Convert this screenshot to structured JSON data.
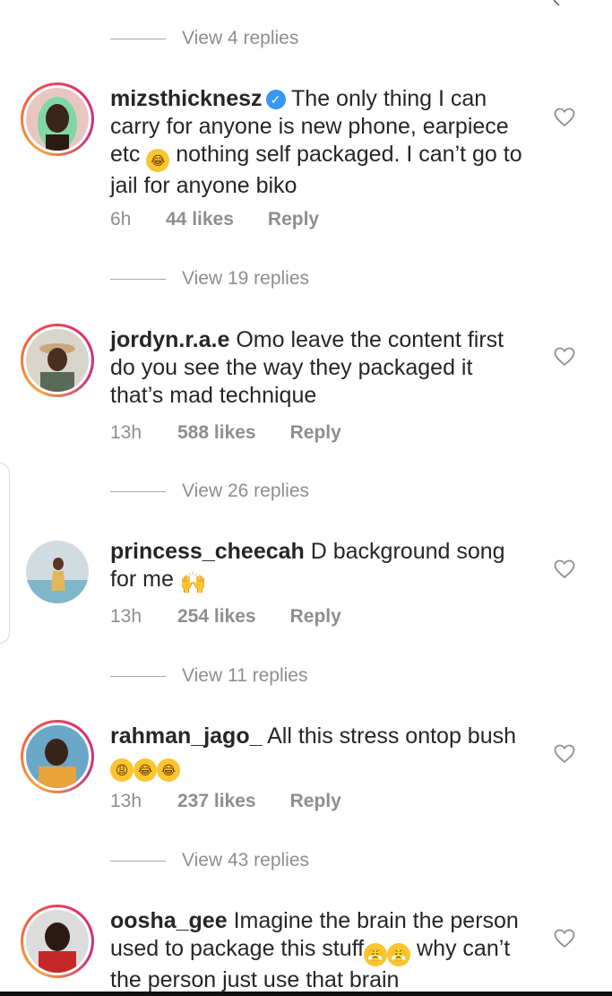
{
  "view_replies": [
    "View 4 replies",
    "View 19 replies",
    "View 26 replies",
    "View 11 replies",
    "View 43 replies"
  ],
  "comments": [
    {
      "username": "mizsthicknesz",
      "verified": true,
      "text_parts": [
        "The only thing I can carry for anyone is new phone, earpiece etc ",
        " nothing self packaged. I can’t go to jail for anyone biko"
      ],
      "time": "6h",
      "likes": "44 likes",
      "reply": "Reply"
    },
    {
      "username": "jordyn.r.a.e",
      "text": "Omo leave the content first do you see the way they packaged it that’s mad technique",
      "time": "13h",
      "likes": "588 likes",
      "reply": "Reply"
    },
    {
      "username": "princess_cheecah",
      "text": "D background song for me ",
      "time": "13h",
      "likes": "254 likes",
      "reply": "Reply"
    },
    {
      "username": "rahman_jago_",
      "text": "All this stress ontop bush ",
      "time": "13h",
      "likes": "237 likes",
      "reply": "Reply"
    },
    {
      "username": "oosha_gee",
      "text": "Imagine the brain the person used to package this stuff",
      "text_tail": "why can’t the person just use that brain",
      "time": "",
      "likes": "",
      "reply": ""
    }
  ],
  "icons": {
    "like": "heart-outline-icon",
    "verified": "verified-badge-icon",
    "emoji_laugh": "face-with-tears-of-joy-emoji",
    "emoji_raise_hands": "raising-hands-emoji",
    "emoji_weary": "weary-face-emoji",
    "emoji_steam": "face-with-steam-emoji"
  },
  "colors": {
    "text": "#262626",
    "secondary": "#8e8e8e",
    "verified": "#3897f0",
    "story_ring": "#e1306c"
  }
}
